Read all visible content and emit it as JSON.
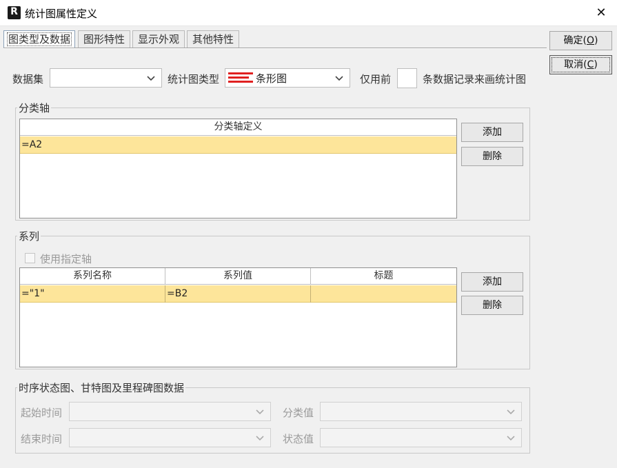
{
  "window": {
    "title": "统计图属性定义",
    "icon_letter": "R",
    "close_glyph": "✕"
  },
  "tabs": [
    {
      "label": "图类型及数据",
      "active": true
    },
    {
      "label": "图形特性",
      "active": false
    },
    {
      "label": "显示外观",
      "active": false
    },
    {
      "label": "其他特性",
      "active": false
    }
  ],
  "buttons": {
    "ok": {
      "label": "确定(",
      "mnemonic": "O",
      "tail": ")"
    },
    "cancel": {
      "label": "取消(",
      "mnemonic": "C",
      "tail": ")"
    }
  },
  "top_row": {
    "dataset_label": "数据集",
    "dataset_value": "",
    "chart_type_label": "统计图类型",
    "chart_type_value": "条形图",
    "chart_type_icon": "bar-chart-icon",
    "only_first_label": "仅用前",
    "only_first_value": "",
    "records_label": "条数据记录来画统计图"
  },
  "category_axis": {
    "group_title": "分类轴",
    "column_header": "分类轴定义",
    "rows": [
      "=A2"
    ],
    "add_label": "添加",
    "delete_label": "删除"
  },
  "series": {
    "group_title": "系列",
    "use_axis_label": "使用指定轴",
    "use_axis_checked": false,
    "columns": [
      "系列名称",
      "系列值",
      "标题"
    ],
    "rows": [
      [
        "=\"1\"",
        "=B2",
        ""
      ]
    ],
    "add_label": "添加",
    "delete_label": "删除"
  },
  "timeline": {
    "group_title": "时序状态图、甘特图及里程碑图数据",
    "start_label": "起始时间",
    "end_label": "结束时间",
    "category_label": "分类值",
    "status_label": "状态值"
  },
  "colors": {
    "selected_row": "#fde59a",
    "chart_icon_red": "#e02020"
  }
}
